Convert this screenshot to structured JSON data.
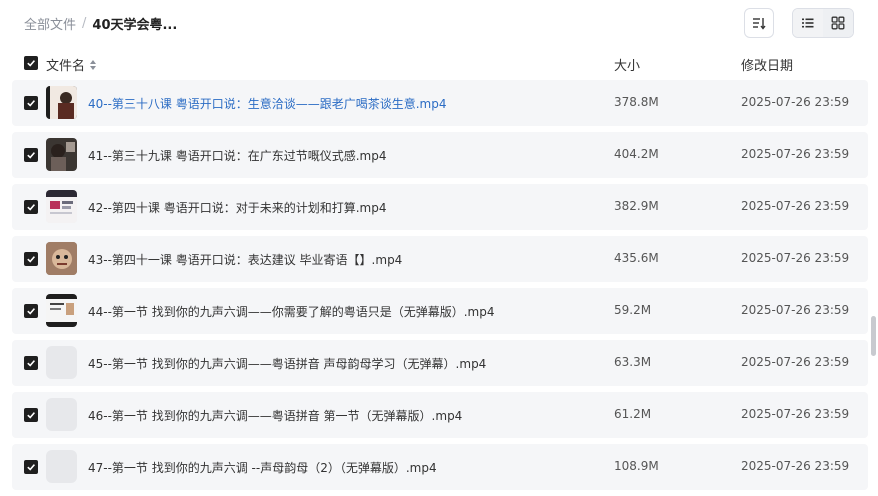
{
  "breadcrumb": {
    "root": "全部文件",
    "separator": "/",
    "current": "40天学会粤..."
  },
  "header": {
    "name": "文件名",
    "size": "大小",
    "date": "修改日期"
  },
  "files": [
    {
      "name": "40--第三十八课 粤语开口说：生意洽谈——跟老广喝茶谈生意.mp4",
      "size": "378.8M",
      "date": "2025-07-26 23:59"
    },
    {
      "name": "41--第三十九课 粤语开口说：在广东过节嘅仪式感.mp4",
      "size": "404.2M",
      "date": "2025-07-26 23:59"
    },
    {
      "name": "42--第四十课 粤语开口说：对于未来的计划和打算.mp4",
      "size": "382.9M",
      "date": "2025-07-26 23:59"
    },
    {
      "name": "43--第四十一课 粤语开口说：表达建议 毕业寄语【】.mp4",
      "size": "435.6M",
      "date": "2025-07-26 23:59"
    },
    {
      "name": "44--第一节 找到你的九声六调——你需要了解的粤语只是（无弹幕版）.mp4",
      "size": "59.2M",
      "date": "2025-07-26 23:59"
    },
    {
      "name": "45--第一节 找到你的九声六调——粤语拼音 声母韵母学习（无弹幕）.mp4",
      "size": "63.3M",
      "date": "2025-07-26 23:59"
    },
    {
      "name": "46--第一节 找到你的九声六调——粤语拼音 第一节（无弹幕版）.mp4",
      "size": "61.2M",
      "date": "2025-07-26 23:59"
    },
    {
      "name": "47--第一节 找到你的九声六调 --声母韵母（2）（无弹幕版）.mp4",
      "size": "108.9M",
      "date": "2025-07-26 23:59"
    }
  ]
}
